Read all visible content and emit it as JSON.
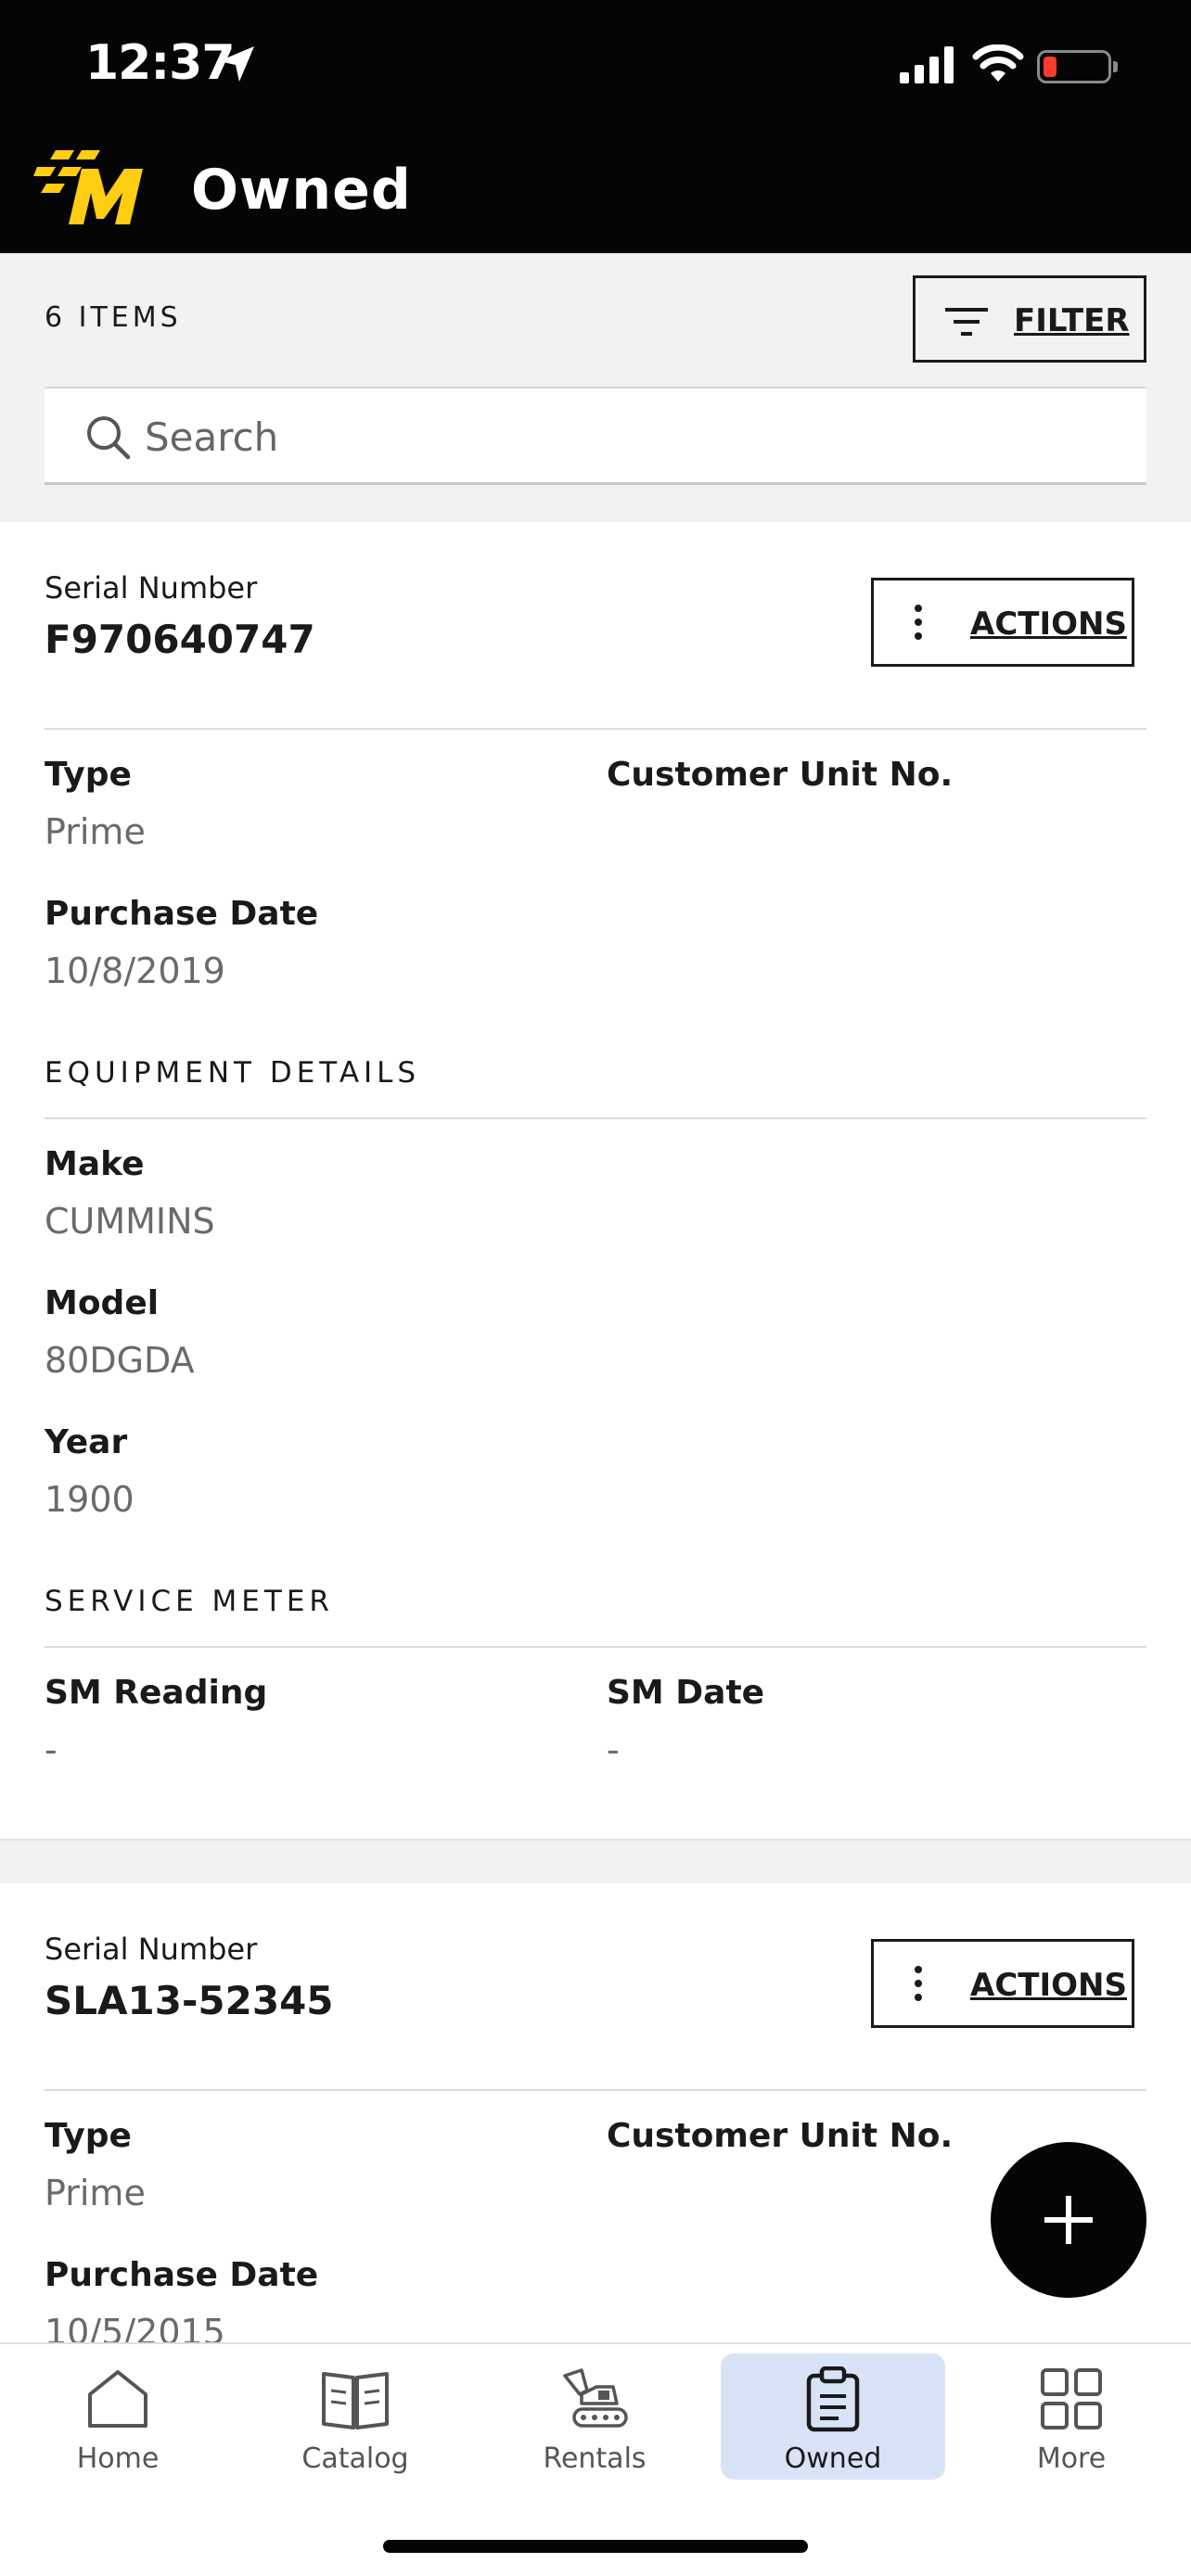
{
  "status_bar": {
    "time": "12:37"
  },
  "header": {
    "title": "Owned"
  },
  "list": {
    "count_label": "6 ITEMS",
    "filter_label": "FILTER"
  },
  "search": {
    "placeholder": "Search"
  },
  "labels": {
    "serial_number": "Serial Number",
    "actions": "ACTIONS",
    "type": "Type",
    "customer_unit_no": "Customer Unit No.",
    "purchase_date": "Purchase Date",
    "equipment_details": "EQUIPMENT DETAILS",
    "make": "Make",
    "model": "Model",
    "year": "Year",
    "service_meter": "SERVICE METER",
    "sm_reading": "SM Reading",
    "sm_date": "SM Date"
  },
  "items": [
    {
      "serial_number": "F970640747",
      "type": "Prime",
      "customer_unit_no": "",
      "purchase_date": "10/8/2019",
      "make": "CUMMINS",
      "model": "80DGDA",
      "year": "1900",
      "sm_reading": "-",
      "sm_date": "-"
    },
    {
      "serial_number": "SLA13-52345",
      "type": "Prime",
      "customer_unit_no": "",
      "purchase_date": "10/5/2015"
    }
  ],
  "tabs": [
    {
      "label": "Home",
      "icon": "home-icon",
      "active": false
    },
    {
      "label": "Catalog",
      "icon": "book-icon",
      "active": false
    },
    {
      "label": "Rentals",
      "icon": "excavator-icon",
      "active": false
    },
    {
      "label": "Owned",
      "icon": "clipboard-icon",
      "active": true
    },
    {
      "label": "More",
      "icon": "grid-icon",
      "active": false
    }
  ],
  "colors": {
    "header_bg": "#050505",
    "brand_yellow": "#ffcd11",
    "active_tab_bg": "#d9e3f7",
    "battery_low": "#ff3b30"
  }
}
